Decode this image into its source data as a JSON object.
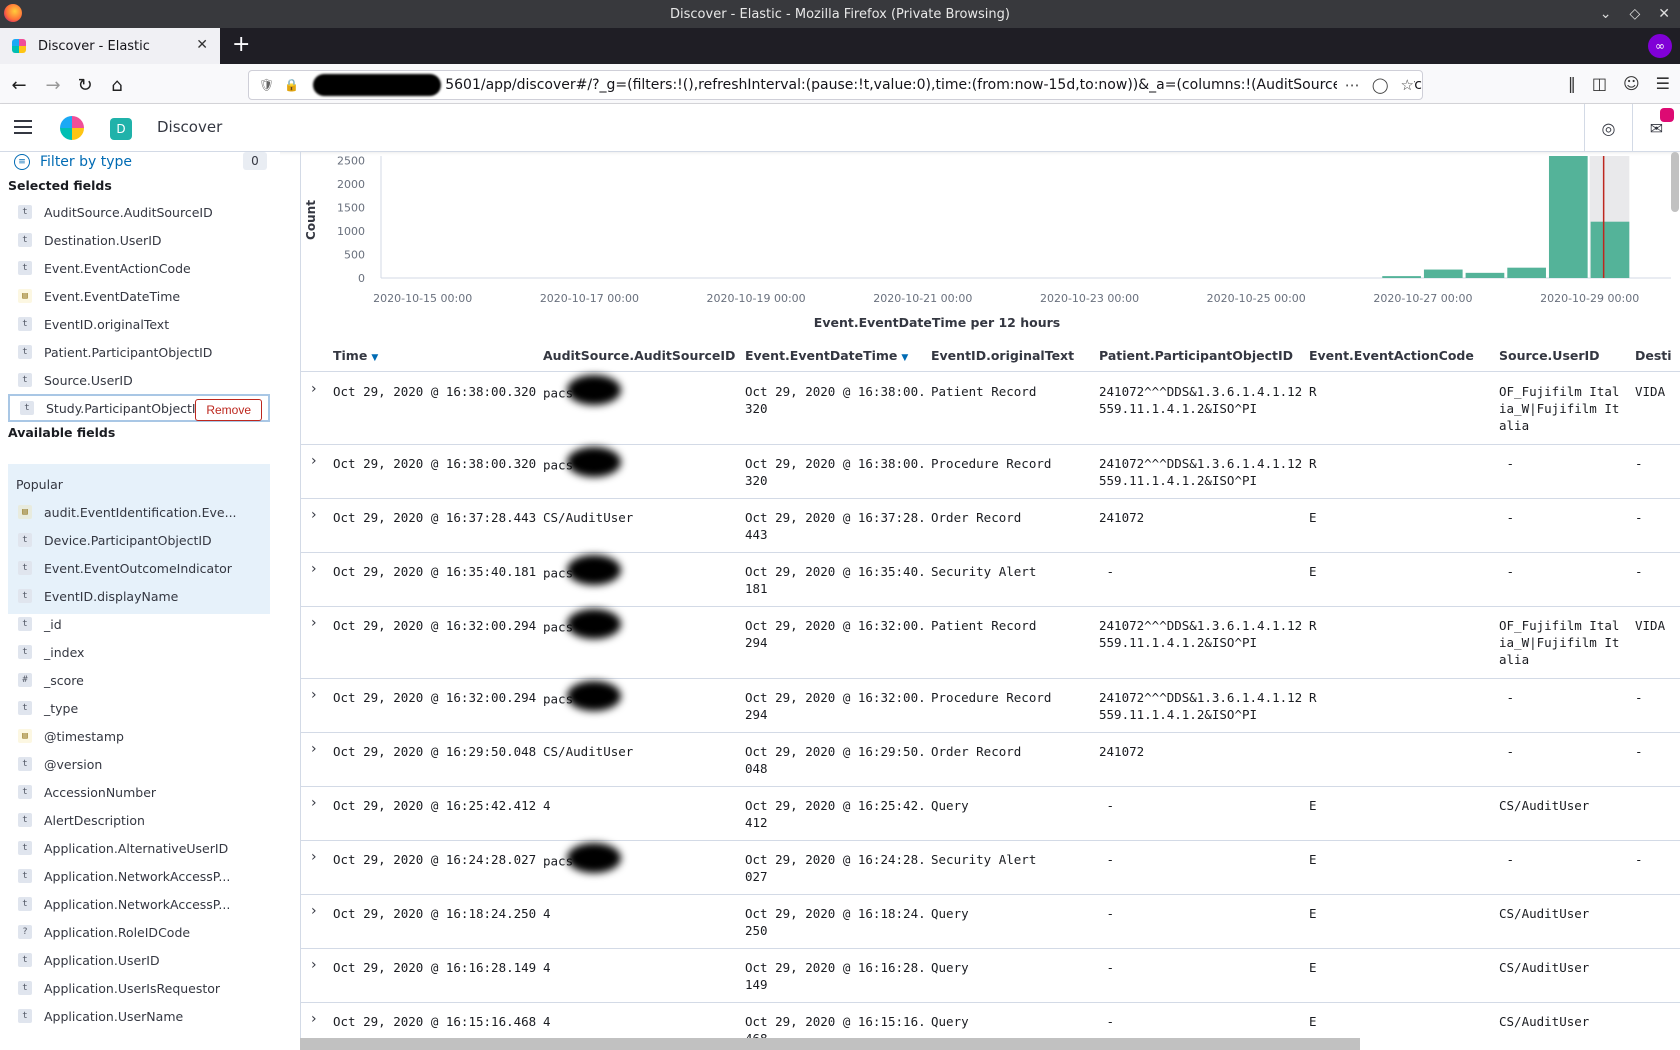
{
  "window": {
    "title": "Discover - Elastic - Mozilla Firefox (Private Browsing)"
  },
  "browser": {
    "tab_title": "Discover - Elastic",
    "url": "5601/app/discover#/?_g=(filters:!(),refreshInterval:(pause:!t,value:0),time:(from:now-15d,to:now))&_a=(columns:!(AuditSource.AuditSourc"
  },
  "header": {
    "space_initial": "D",
    "app_title": "Discover"
  },
  "sidebar": {
    "filter_label": "Filter by type",
    "filter_count": "0",
    "selected_title": "Selected fields",
    "selected": [
      {
        "type": "t",
        "name": "AuditSource.AuditSourceID"
      },
      {
        "type": "t",
        "name": "Destination.UserID"
      },
      {
        "type": "t",
        "name": "Event.EventActionCode"
      },
      {
        "type": "date",
        "name": "Event.EventDateTime"
      },
      {
        "type": "t",
        "name": "EventID.originalText"
      },
      {
        "type": "t",
        "name": "Patient.ParticipantObjectID"
      },
      {
        "type": "t",
        "name": "Source.UserID"
      },
      {
        "type": "t",
        "name": "Study.ParticipantObjectID"
      }
    ],
    "remove_label": "Remove",
    "available_title": "Available fields",
    "popular_label": "Popular",
    "popular": [
      {
        "type": "date",
        "name": "audit.EventIdentification.Eve..."
      },
      {
        "type": "t",
        "name": "Device.ParticipantObjectID"
      },
      {
        "type": "t",
        "name": "Event.EventOutcomeIndicator"
      },
      {
        "type": "t",
        "name": "EventID.displayName"
      }
    ],
    "available": [
      {
        "type": "t",
        "name": "_id"
      },
      {
        "type": "t",
        "name": "_index"
      },
      {
        "type": "#",
        "name": "_score"
      },
      {
        "type": "t",
        "name": "_type"
      },
      {
        "type": "date",
        "name": "@timestamp"
      },
      {
        "type": "t",
        "name": "@version"
      },
      {
        "type": "t",
        "name": "AccessionNumber"
      },
      {
        "type": "t",
        "name": "AlertDescription"
      },
      {
        "type": "t",
        "name": "Application.AlternativeUserID"
      },
      {
        "type": "t",
        "name": "Application.NetworkAccessP..."
      },
      {
        "type": "t",
        "name": "Application.NetworkAccessP..."
      },
      {
        "type": "?",
        "name": "Application.RoleIDCode"
      },
      {
        "type": "t",
        "name": "Application.UserID"
      },
      {
        "type": "t",
        "name": "Application.UserIsRequestor"
      },
      {
        "type": "t",
        "name": "Application.UserName"
      }
    ]
  },
  "chart_data": {
    "type": "bar",
    "ylabel": "Count",
    "xlabel": "Event.EventDateTime per 12 hours",
    "y_ticks": [
      "2500",
      "2000",
      "1500",
      "1000",
      "500",
      "0"
    ],
    "y_tick_values": [
      2500,
      2000,
      1500,
      1000,
      500,
      0
    ],
    "ylim": [
      0,
      2600
    ],
    "x_ticks": [
      "2020-10-15 00:00",
      "2020-10-17 00:00",
      "2020-10-19 00:00",
      "2020-10-21 00:00",
      "2020-10-23 00:00",
      "2020-10-25 00:00",
      "2020-10-27 00:00",
      "2020-10-29 00:00"
    ],
    "bars": [
      {
        "start": "2020-10-26 12:00",
        "value": 40
      },
      {
        "start": "2020-10-27 00:00",
        "value": 180
      },
      {
        "start": "2020-10-27 12:00",
        "value": 110
      },
      {
        "start": "2020-10-28 00:00",
        "value": 220
      },
      {
        "start": "2020-10-28 12:00",
        "value": 2600
      },
      {
        "start": "2020-10-29 00:00",
        "value": 1200
      }
    ],
    "color": "#54b399"
  },
  "table": {
    "columns": [
      "Time",
      "AuditSource.AuditSourceID",
      "Event.EventDateTime",
      "EventID.originalText",
      "Patient.ParticipantObjectID",
      "Event.EventActionCode",
      "Source.UserID",
      "Desti"
    ],
    "rows": [
      {
        "time": "Oct 29, 2020 @ 16:38:00.320",
        "src": "pacs",
        "redacted": true,
        "edt": "Oct 29, 2020 @ 16:38:00.\n320",
        "text": "Patient Record",
        "pid": "241072^^^DDS&1.3.6.1.4.1.12\n559.11.1.4.1.2&ISO^PI",
        "code": "R",
        "user": "OF_Fujifilm Ital\nia_W|Fujifilm It\nalia",
        "dest": "VIDA"
      },
      {
        "time": "Oct 29, 2020 @ 16:38:00.320",
        "src": "pacs",
        "redacted": true,
        "edt": "Oct 29, 2020 @ 16:38:00.\n320",
        "text": "Procedure Record",
        "pid": "241072^^^DDS&1.3.6.1.4.1.12\n559.11.1.4.1.2&ISO^PI",
        "code": "R",
        "user": " -",
        "dest": "-"
      },
      {
        "time": "Oct 29, 2020 @ 16:37:28.443",
        "src": "CS/AuditUser",
        "redacted": false,
        "edt": "Oct 29, 2020 @ 16:37:28.\n443",
        "text": "Order Record",
        "pid": "241072",
        "code": "E",
        "user": " -",
        "dest": "-"
      },
      {
        "time": "Oct 29, 2020 @ 16:35:40.181",
        "src": "pacs",
        "redacted": true,
        "edt": "Oct 29, 2020 @ 16:35:40.\n181",
        "text": "Security Alert",
        "pid": " -",
        "code": "E",
        "user": " -",
        "dest": "-"
      },
      {
        "time": "Oct 29, 2020 @ 16:32:00.294",
        "src": "pacs",
        "redacted": true,
        "edt": "Oct 29, 2020 @ 16:32:00.\n294",
        "text": "Patient Record",
        "pid": "241072^^^DDS&1.3.6.1.4.1.12\n559.11.1.4.1.2&ISO^PI",
        "code": "R",
        "user": "OF_Fujifilm Ital\nia_W|Fujifilm It\nalia",
        "dest": "VIDA"
      },
      {
        "time": "Oct 29, 2020 @ 16:32:00.294",
        "src": "pacs",
        "redacted": true,
        "edt": "Oct 29, 2020 @ 16:32:00.\n294",
        "text": "Procedure Record",
        "pid": "241072^^^DDS&1.3.6.1.4.1.12\n559.11.1.4.1.2&ISO^PI",
        "code": "R",
        "user": " -",
        "dest": "-"
      },
      {
        "time": "Oct 29, 2020 @ 16:29:50.048",
        "src": "CS/AuditUser",
        "redacted": false,
        "edt": "Oct 29, 2020 @ 16:29:50.\n048",
        "text": "Order Record",
        "pid": "241072",
        "code": "",
        "user": " -",
        "dest": "-"
      },
      {
        "time": "Oct 29, 2020 @ 16:25:42.412",
        "src": "4",
        "redacted": false,
        "edt": "Oct 29, 2020 @ 16:25:42.\n412",
        "text": "Query",
        "pid": " -",
        "code": "E",
        "user": "CS/AuditUser",
        "dest": ""
      },
      {
        "time": "Oct 29, 2020 @ 16:24:28.027",
        "src": "pacs",
        "redacted": true,
        "edt": "Oct 29, 2020 @ 16:24:28.\n027",
        "text": "Security Alert",
        "pid": " -",
        "code": "E",
        "user": " -",
        "dest": "-"
      },
      {
        "time": "Oct 29, 2020 @ 16:18:24.250",
        "src": "4",
        "redacted": false,
        "edt": "Oct 29, 2020 @ 16:18:24.\n250",
        "text": "Query",
        "pid": " -",
        "code": "E",
        "user": "CS/AuditUser",
        "dest": ""
      },
      {
        "time": "Oct 29, 2020 @ 16:16:28.149",
        "src": "4",
        "redacted": false,
        "edt": "Oct 29, 2020 @ 16:16:28.\n149",
        "text": "Query",
        "pid": " -",
        "code": "E",
        "user": "CS/AuditUser",
        "dest": ""
      },
      {
        "time": "Oct 29, 2020 @ 16:15:16.468",
        "src": "4",
        "redacted": false,
        "edt": "Oct 29, 2020 @ 16:15:16.\n468",
        "text": "Query",
        "pid": " -",
        "code": "E",
        "user": "CS/AuditUser",
        "dest": ""
      }
    ]
  }
}
